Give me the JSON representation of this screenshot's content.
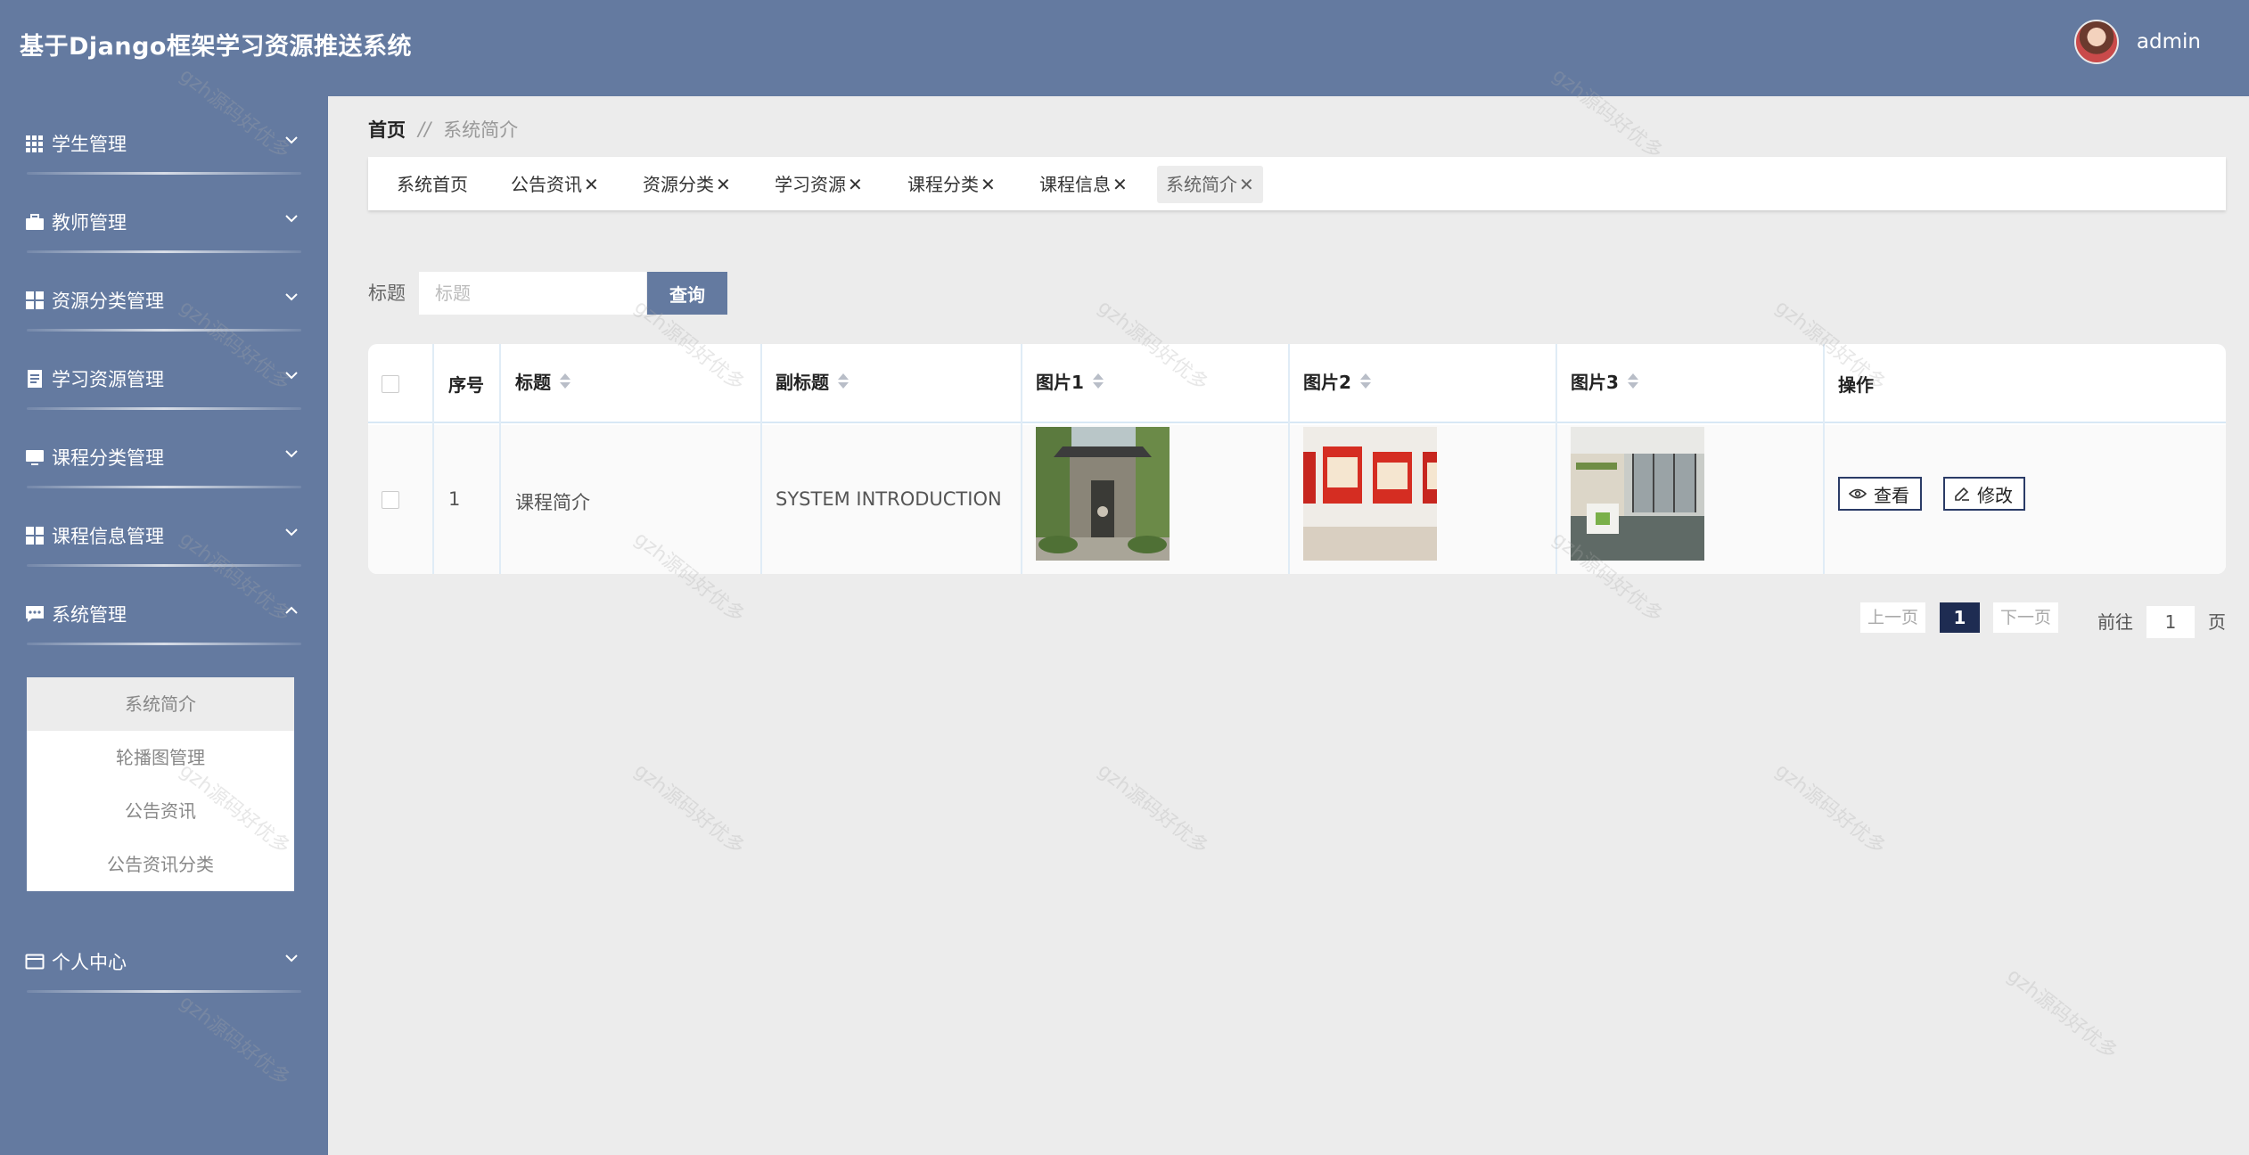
{
  "header": {
    "title": "基于Django框架学习资源推送系统",
    "user_name": "admin"
  },
  "sidebar": {
    "items": [
      {
        "label": "学生管理",
        "icon": "grid-icon"
      },
      {
        "label": "教师管理",
        "icon": "briefcase-icon"
      },
      {
        "label": "资源分类管理",
        "icon": "dashboard-icon"
      },
      {
        "label": "学习资源管理",
        "icon": "document-icon"
      },
      {
        "label": "课程分类管理",
        "icon": "monitor-icon"
      },
      {
        "label": "课程信息管理",
        "icon": "dashboard-icon"
      },
      {
        "label": "系统管理",
        "icon": "chat-icon",
        "expanded": true
      },
      {
        "label": "个人中心",
        "icon": "card-icon"
      }
    ],
    "submenu": [
      {
        "label": "系统简介",
        "active": true
      },
      {
        "label": "轮播图管理"
      },
      {
        "label": "公告资讯"
      },
      {
        "label": "公告资讯分类"
      }
    ]
  },
  "breadcrumb": {
    "home": "首页",
    "separator": "//",
    "current": "系统简介"
  },
  "tabs": [
    {
      "label": "系统首页"
    },
    {
      "label": "公告资讯",
      "close": "✕"
    },
    {
      "label": "资源分类",
      "close": "✕"
    },
    {
      "label": "学习资源",
      "close": "✕"
    },
    {
      "label": "课程分类",
      "close": "✕"
    },
    {
      "label": "课程信息",
      "close": "✕"
    },
    {
      "label": "系统简介",
      "close": "✕",
      "active": true
    }
  ],
  "search": {
    "label": "标题",
    "placeholder": "标题",
    "button": "查询"
  },
  "table": {
    "columns": [
      "序号",
      "标题",
      "副标题",
      "图片1",
      "图片2",
      "图片3",
      "操作"
    ],
    "rows": [
      {
        "index": "1",
        "title": "课程简介",
        "subtitle": "SYSTEM INTRODUCTION",
        "actions": {
          "view": "查看",
          "edit": "修改"
        }
      }
    ]
  },
  "pagination": {
    "prev": "上一页",
    "current": "1",
    "next": "下一页",
    "goto_prefix": "前往",
    "goto_value": "1",
    "goto_suffix": "页"
  },
  "watermark": "gzh源码好优多",
  "colors": {
    "primary": "#647aa0",
    "background": "#ececec",
    "pager_active": "#1e2c52"
  }
}
